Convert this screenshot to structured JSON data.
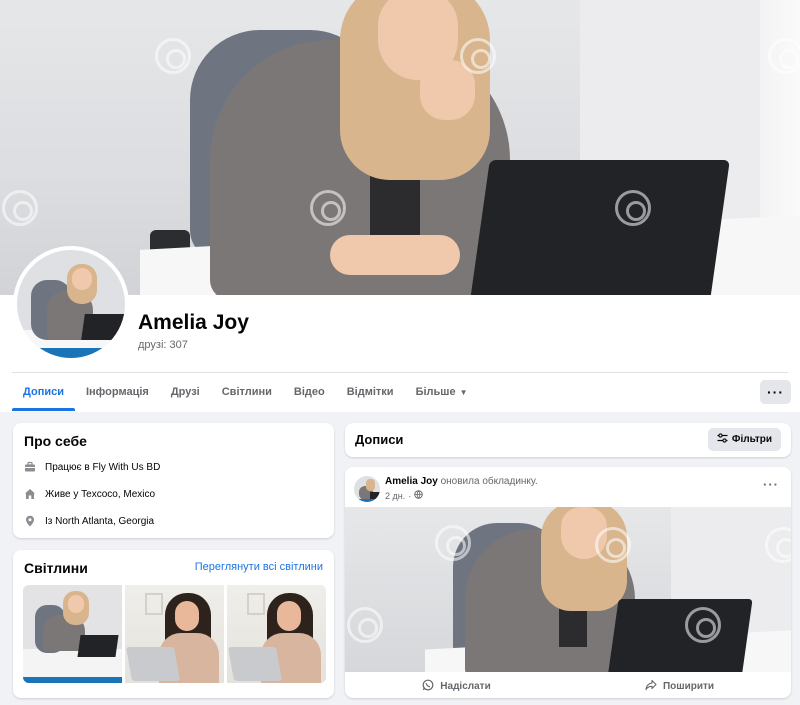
{
  "profile": {
    "name": "Amelia Joy",
    "friends": "друзі: 307"
  },
  "tabs": [
    {
      "label": "Дописи",
      "active": true
    },
    {
      "label": "Інформація"
    },
    {
      "label": "Друзі"
    },
    {
      "label": "Світлини"
    },
    {
      "label": "Відео"
    },
    {
      "label": "Відмітки"
    },
    {
      "label": "Більше"
    }
  ],
  "more_button": "···",
  "about": {
    "title": "Про себе",
    "items": [
      {
        "icon": "briefcase-icon",
        "text": "Працює в Fly With Us BD"
      },
      {
        "icon": "home-icon",
        "text": "Живе у Texcoco, Mexico"
      },
      {
        "icon": "location-pin-icon",
        "text": "Із North Atlanta, Georgia"
      }
    ]
  },
  "photos": {
    "title": "Світлини",
    "see_all": "Переглянути всі світлини"
  },
  "posts": {
    "title": "Дописи",
    "filter_label": "Фільтри"
  },
  "post": {
    "author": "Amelia Joy",
    "action": "оновила обкладинку.",
    "time": "2 дн.",
    "more": "···",
    "send_label": "Надіслати",
    "share_label": "Поширити"
  },
  "colors": {
    "accent": "#1b74e4",
    "background": "#f0f2f5",
    "muted_text": "#65676b",
    "button_bg": "#e4e6eb"
  }
}
